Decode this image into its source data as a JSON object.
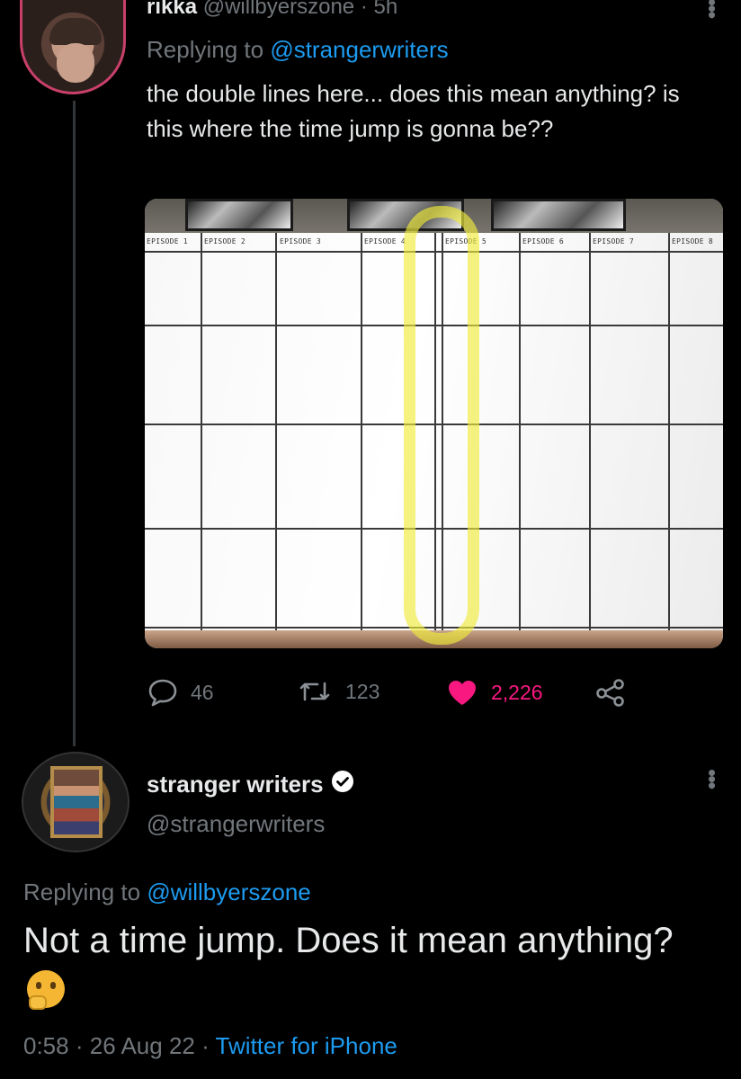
{
  "tweet1": {
    "name": "rikka",
    "handle": "@willbyerszone",
    "separator": "·",
    "time": "5h",
    "replying_prefix": "Replying to",
    "replying_to": "@strangerwriters",
    "text": "the double lines here... does this mean anything? is this where the time jump is gonna be??",
    "media": {
      "episode_labels": [
        "EPISODE 1",
        "EPISODE 2",
        "EPISODE 3",
        "EPISODE 4",
        "EPISODE 5",
        "EPISODE 6",
        "EPISODE 7",
        "EPISODE 8"
      ]
    },
    "actions": {
      "replies": "46",
      "retweets": "123",
      "likes": "2,226",
      "liked": true
    }
  },
  "tweet2": {
    "name": "stranger writers",
    "verified": true,
    "handle": "@strangerwriters",
    "replying_prefix": "Replying to",
    "replying_to": "@willbyerszone",
    "text": "Not a time jump. Does it mean anything?",
    "emoji": "thinking-face",
    "time": "0:58",
    "date": "26 Aug 22",
    "client": "Twitter for iPhone",
    "separator": "·"
  },
  "colors": {
    "background": "#000000",
    "text": "#e7e9ea",
    "muted": "#71767b",
    "link": "#1d9bf0",
    "like": "#f91880",
    "verified_badge": "#ffffff"
  }
}
